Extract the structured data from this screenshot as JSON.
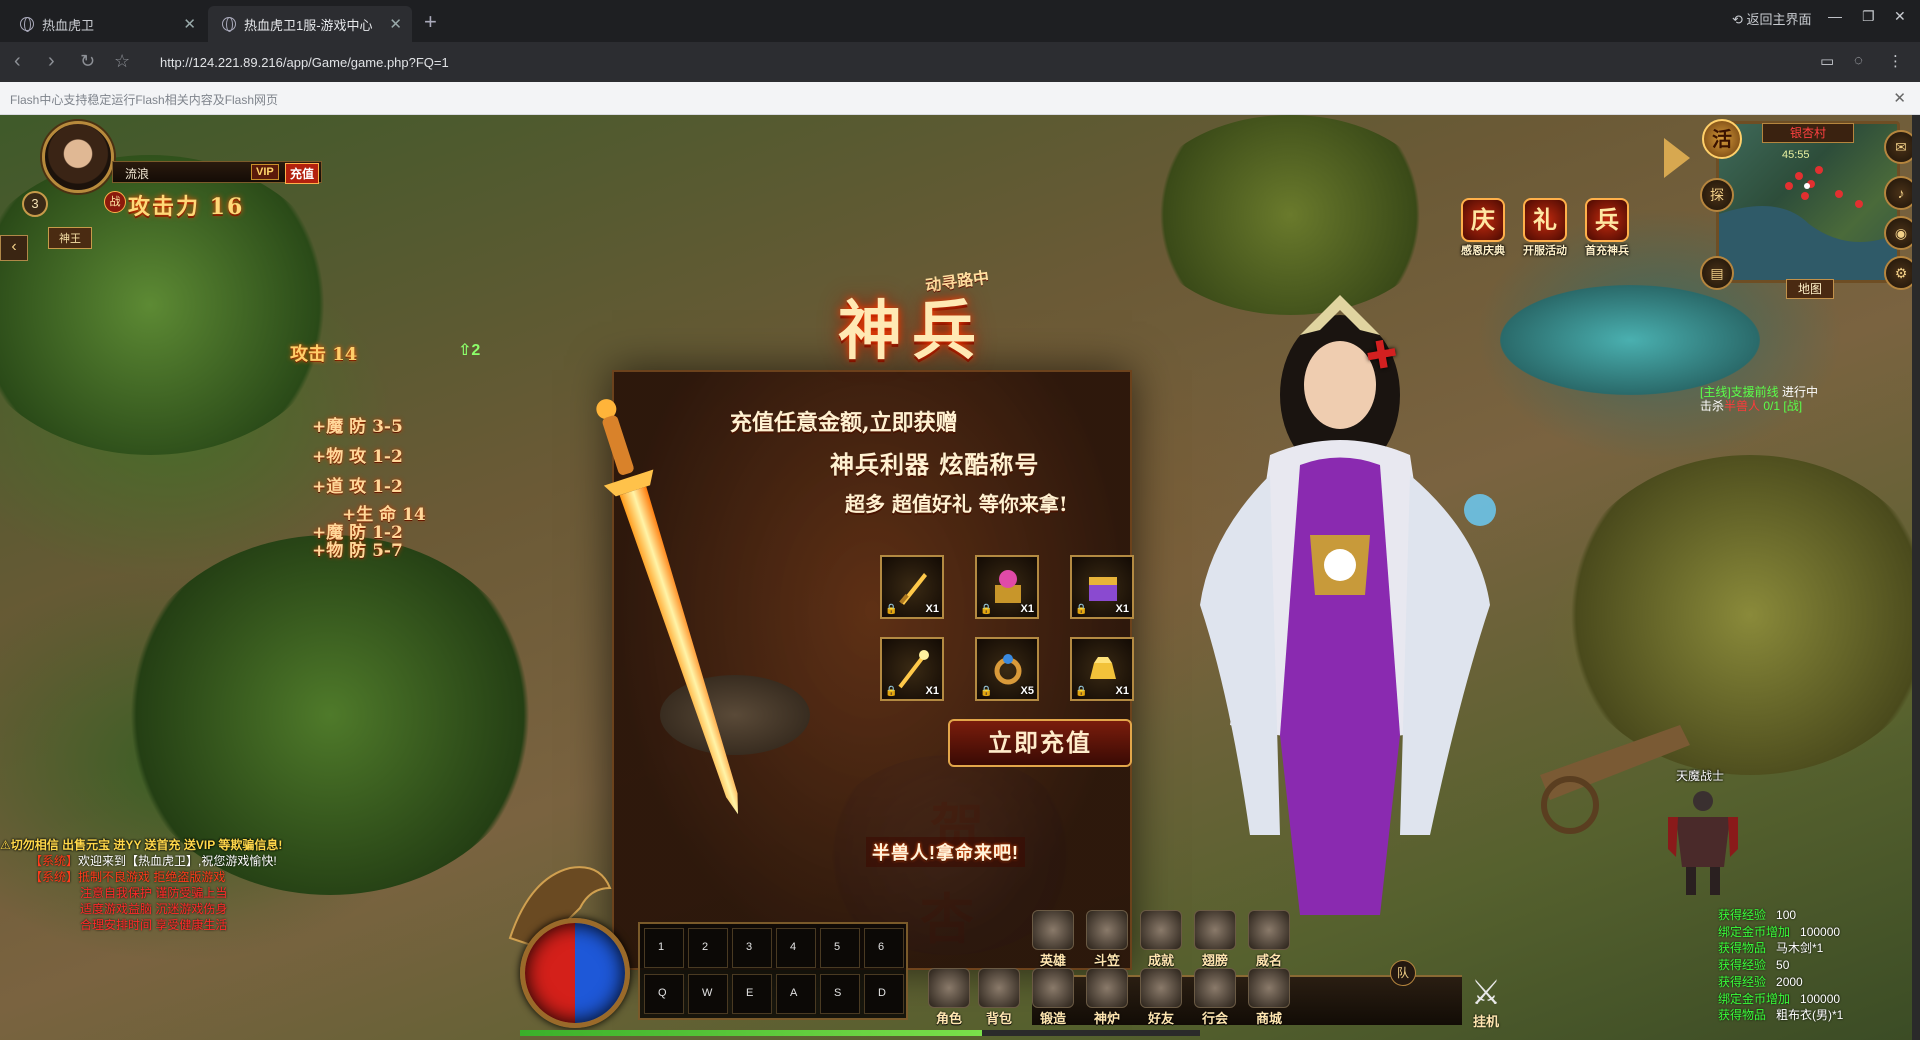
{
  "browser": {
    "tabs": [
      {
        "title": "热血虎卫"
      },
      {
        "title": "热血虎卫1服-游戏中心"
      }
    ],
    "new_tab": "+",
    "back_to_main": "返回主界面",
    "url": "http://124.221.89.216/app/Game/game.php?FQ=1",
    "flash_notice": "Flash中心支持稳定运行Flash相关内容及Flash网页"
  },
  "player": {
    "level": "3",
    "name": "流浪",
    "vip": "VIP",
    "charge": "充值",
    "zhan": "战",
    "attack": "攻击力 16",
    "guild": "神王"
  },
  "attr_popup": {
    "main": "攻击 14",
    "up": "2",
    "lines": [
      "+魔 防 3-5",
      "+物 攻 1-2",
      "+道 攻 1-2",
      "+生 命 14",
      "+魔 防 1-2",
      "+物 防 5-7"
    ]
  },
  "promo": {
    "badge": "动寻路中",
    "title": "神兵",
    "line1": "充值任意金额,立即获赠",
    "line2": "神兵利器  炫酷称号",
    "line3": "超多 超值好礼 等你来拿!",
    "items": [
      {
        "count": "X1",
        "icon": "golden-sword"
      },
      {
        "count": "X1",
        "icon": "treasure-box"
      },
      {
        "count": "X1",
        "icon": "gift-chest"
      },
      {
        "count": "X1",
        "icon": "golden-staff"
      },
      {
        "count": "X5",
        "icon": "jade-ring"
      },
      {
        "count": "X1",
        "icon": "gold-ingot"
      }
    ],
    "button": "立即充值"
  },
  "events": [
    {
      "label": "感恩庆典",
      "glyph": "庆"
    },
    {
      "label": "开服活动",
      "glyph": "礼"
    },
    {
      "label": "首充神兵",
      "glyph": "兵"
    }
  ],
  "minimap": {
    "name": "银杏村",
    "coords": "45:55",
    "map_button": "地图",
    "huo": "活",
    "tan": "探"
  },
  "quest": {
    "line1_tag": "[主线]支援前线",
    "line1_status": "进行中",
    "line2_pre": "击杀",
    "line2_target": "半兽人",
    "line2_progress": "0/1",
    "line2_action": "[战]"
  },
  "npc_name": "天魔战士",
  "chat": {
    "warning": "切勿相信 出售元宝 进YY 送首充 送VIP 等欺骗信息!",
    "sys1_tag": "【系统】",
    "sys1_text": "欢迎来到【热血虎卫】,祝您游戏愉快!",
    "sys2_tag": "【系统】",
    "sys2_text": "抵制不良游戏 拒绝盗版游戏",
    "sys_lines": [
      "注意自我保护 谨防受骗上当",
      "适度游戏益脑 沉迷游戏伤身",
      "合理安排时间 享受健康生活"
    ]
  },
  "shout": "半兽人!拿命来吧!",
  "hud": {
    "slots_top": [
      "1",
      "2",
      "3",
      "4",
      "5",
      "6"
    ],
    "slots_bottom": [
      "Q",
      "W",
      "E",
      "A",
      "S",
      "D"
    ],
    "menu_top": [
      "英雄",
      "斗笠",
      "成就",
      "翅膀",
      "威名"
    ],
    "menu_bottom": [
      "角色",
      "背包",
      "锻造",
      "神炉",
      "好友",
      "行会",
      "商城"
    ],
    "team": "队",
    "afk": "挂机",
    "exp_percent": 68
  },
  "gains": [
    {
      "label": "获得经验",
      "value": "100"
    },
    {
      "label": "绑定金币增加",
      "value": "100000"
    },
    {
      "label": "获得物品",
      "value": "马木剑*1"
    },
    {
      "label": "获得经验",
      "value": "50"
    },
    {
      "label": "获得经验",
      "value": "2000"
    },
    {
      "label": "绑定金币增加",
      "value": "100000"
    },
    {
      "label": "获得物品",
      "value": "粗布衣(男)*1"
    }
  ],
  "ground_text": {
    "char1": "贺",
    "char2": "杏"
  },
  "colors": {
    "accent_gold": "#e2a64a",
    "chat_red": "#ff3a1a",
    "gain_green": "#3aff3a"
  }
}
